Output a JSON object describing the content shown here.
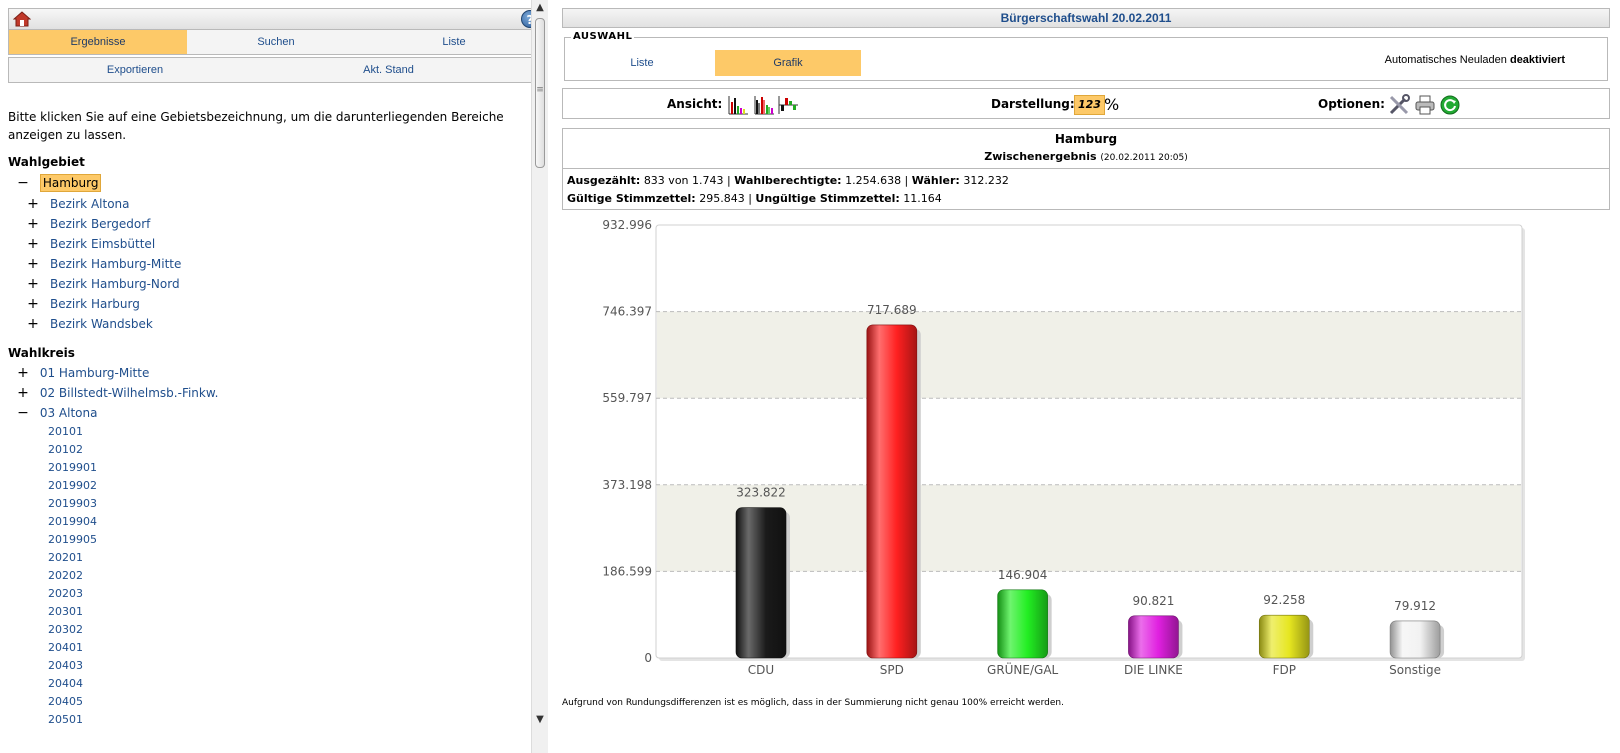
{
  "left": {
    "nav_row1": [
      "Ergebnisse",
      "Suchen",
      "Liste"
    ],
    "nav_row2": [
      "Exportieren",
      "Akt. Stand"
    ],
    "intro": "Bitte klicken Sie auf eine Gebietsbezeichnung, um die darunterliegenden Bereiche anzeigen zu lassen.",
    "wahlgebiet_title": "Wahlgebiet",
    "wahlgebiet_root": "Hamburg",
    "bezirke": [
      "Bezirk Altona",
      "Bezirk Bergedorf",
      "Bezirk Eimsbüttel",
      "Bezirk Hamburg-Mitte",
      "Bezirk Hamburg-Nord",
      "Bezirk Harburg",
      "Bezirk Wandsbek"
    ],
    "wahlkreis_title": "Wahlkreis",
    "wahlkreise": [
      "01 Hamburg-Mitte",
      "02 Billstedt-Wilhelmsb.-Finkw.",
      "03 Altona"
    ],
    "altona_children": [
      "20101",
      "20102",
      "2019901",
      "2019902",
      "2019903",
      "2019904",
      "2019905",
      "20201",
      "20202",
      "20203",
      "20301",
      "20302",
      "20401",
      "20403",
      "20404",
      "20405",
      "20501"
    ]
  },
  "right": {
    "title": "Bürgerschaftswahl 20.02.2011",
    "auswahl_legend": "AUSWAHL",
    "tabs": [
      "Liste",
      "Grafik"
    ],
    "reload_text": "Automatisches Neuladen",
    "reload_state": "deaktiviert",
    "ansicht_label": "Ansicht:",
    "darstellung_label": "Darstellung:",
    "darstellung_num": "123",
    "darstellung_pct": "%",
    "optionen_label": "Optionen:",
    "area": "Hamburg",
    "stand": "Zwischenergebnis",
    "stand_time": "(20.02.2011 20:05)",
    "stats": {
      "ausgezaehlt_label": "Ausgezählt:",
      "ausgezaehlt": "833 von 1.743",
      "wahlberechtigte_label": "Wahlberechtigte:",
      "wahlberechtigte": "1.254.638",
      "waehler_label": "Wähler:",
      "waehler": "312.232",
      "gueltig_label": "Gültige Stimmzettel:",
      "gueltig": "295.843",
      "ungueltig_label": "Ungültige Stimmzettel:",
      "ungueltig": "11.164"
    },
    "footnote": "Aufgrund von Rundungsdifferenzen ist es möglich, dass in der Summierung nicht genau 100% erreicht werden."
  },
  "icons": {
    "home": "home-icon",
    "help": "help-icon",
    "ansicht": [
      "bar-chart-icon",
      "grouped-bar-chart-icon",
      "diff-chart-icon"
    ],
    "optionen": [
      "tools-icon",
      "print-icon",
      "refresh-icon"
    ]
  },
  "colors": {
    "accent": "#fdc968",
    "link": "#1f4e8c"
  },
  "chart_data": {
    "type": "bar",
    "categories": [
      "CDU",
      "SPD",
      "GRÜNE/GAL",
      "DIE LINKE",
      "FDP",
      "Sonstige"
    ],
    "values": [
      323822,
      717689,
      146904,
      90821,
      92258,
      79912
    ],
    "value_labels": [
      "323.822",
      "717.689",
      "146.904",
      "90.821",
      "92.258",
      "79.912"
    ],
    "colors": [
      "#1a1a1a",
      "#ff2020",
      "#22ee22",
      "#e020e0",
      "#e6e620",
      "#f2f2f2"
    ],
    "ylim": [
      0,
      932996
    ],
    "yticks": [
      0,
      186599,
      373198,
      559797,
      746397,
      932996
    ],
    "ytick_labels": [
      "0",
      "186.599",
      "373.198",
      "559.797",
      "746.397",
      "932.996"
    ],
    "grid": true
  }
}
